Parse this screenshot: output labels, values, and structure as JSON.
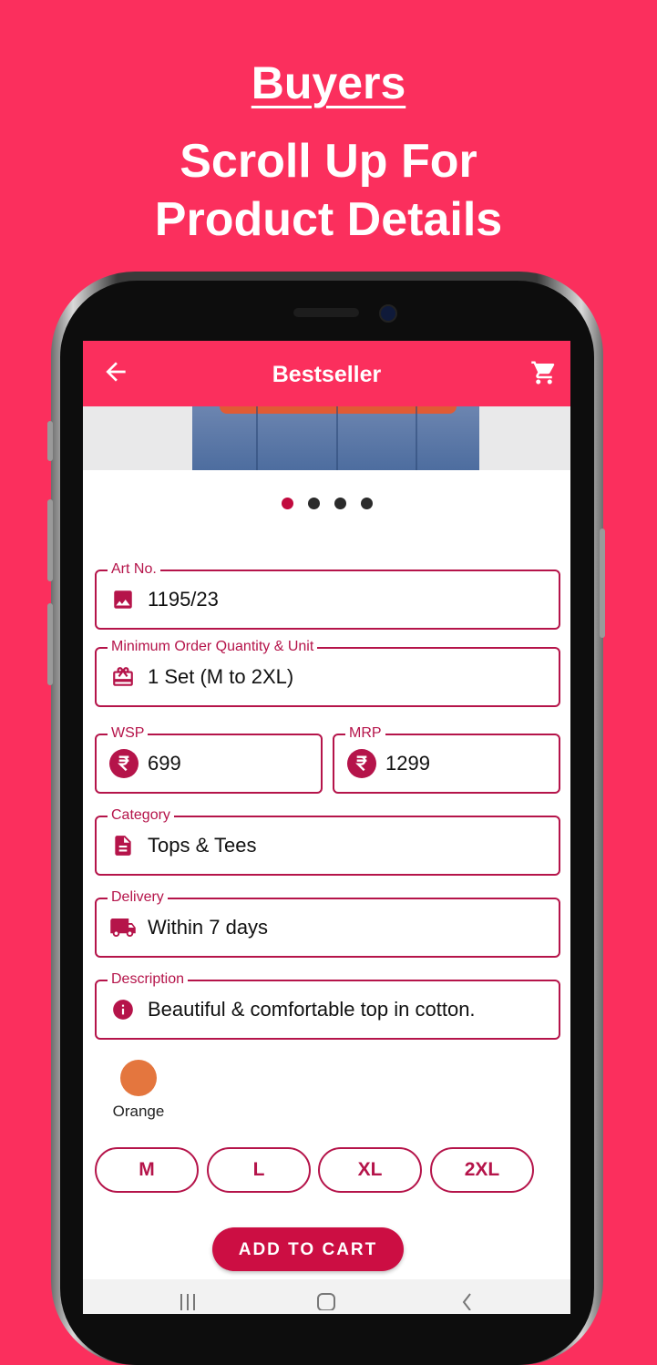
{
  "promo": {
    "title": "Buyers",
    "subtitle_line1": "Scroll Up For",
    "subtitle_line2": "Product Details"
  },
  "appbar": {
    "title": "Bestseller",
    "back_icon": "arrow-back-icon",
    "cart_icon": "shopping-cart-icon"
  },
  "carousel": {
    "total": 4,
    "active_index": 0
  },
  "fields": {
    "art_no": {
      "label": "Art No.",
      "value": "1195/23",
      "icon": "image-icon"
    },
    "moq": {
      "label": "Minimum Order Quantity & Unit",
      "value": "1 Set (M to 2XL)",
      "icon": "gift-card-icon"
    },
    "wsp": {
      "label": "WSP",
      "value": "699",
      "icon": "rupee-icon"
    },
    "mrp": {
      "label": "MRP",
      "value": "1299",
      "icon": "rupee-icon"
    },
    "category": {
      "label": "Category",
      "value": "Tops & Tees",
      "icon": "document-icon"
    },
    "delivery": {
      "label": "Delivery",
      "value": "Within 7 days",
      "icon": "truck-icon"
    },
    "description": {
      "label": "Description",
      "value": "Beautiful & comfortable top in cotton.",
      "icon": "info-icon"
    }
  },
  "color": {
    "name": "Orange",
    "hex": "#e4763e"
  },
  "sizes": [
    "M",
    "L",
    "XL",
    "2XL"
  ],
  "add_to_cart": "ADD TO CART",
  "colors": {
    "brand": "#fb2f5d",
    "accent": "#b5144a",
    "button": "#cc0e43"
  }
}
